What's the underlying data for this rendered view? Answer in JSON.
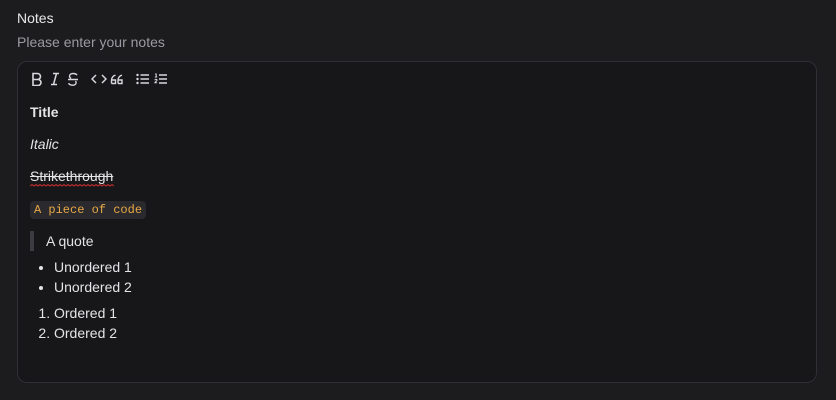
{
  "field": {
    "label": "Notes",
    "description": "Please enter your notes"
  },
  "toolbar": {
    "buttons": [
      {
        "name": "bold",
        "icon": "bold-icon"
      },
      {
        "name": "italic",
        "icon": "italic-icon"
      },
      {
        "name": "strikethrough",
        "icon": "strikethrough-icon"
      },
      {
        "name": "code",
        "icon": "code-icon"
      },
      {
        "name": "quote",
        "icon": "quote-icon"
      },
      {
        "name": "bullet-list",
        "icon": "bullet-list-icon"
      },
      {
        "name": "ordered-list",
        "icon": "ordered-list-icon"
      }
    ]
  },
  "content": {
    "title": "Title",
    "italic": "Italic",
    "strikethrough": "Strikethrough",
    "code": "A piece of code",
    "quote": "A quote",
    "unordered": [
      "Unordered 1",
      "Unordered 2"
    ],
    "ordered": [
      "Ordered 1",
      "Ordered 2"
    ]
  },
  "colors": {
    "background": "#1c1c1f",
    "editor_background": "#17171a",
    "code_text": "#e8a845",
    "spellcheck_underline": "#d03030"
  }
}
